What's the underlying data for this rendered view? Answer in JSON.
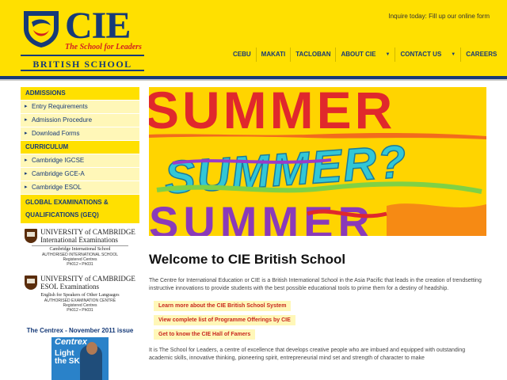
{
  "header": {
    "logo": {
      "name": "CIE",
      "tagline": "The School for Leaders",
      "subtitle": "BRITISH SCHOOL"
    },
    "inquire_text": "Inquire today: Fill up our online form",
    "nav": [
      {
        "label": "CEBU",
        "dropdown": false
      },
      {
        "label": "MAKATI",
        "dropdown": false
      },
      {
        "label": "TACLOBAN",
        "dropdown": false
      },
      {
        "label": "ABOUT CIE",
        "dropdown": true
      },
      {
        "label": "CONTACT US",
        "dropdown": true
      },
      {
        "label": "CAREERS",
        "dropdown": true
      }
    ],
    "colors": {
      "yellow": "#ffe000",
      "navy": "#163a78",
      "red": "#d22020"
    }
  },
  "sidebar": {
    "admissions": {
      "heading": "ADMISSIONS",
      "items": [
        "Entry Requirements",
        "Admission Procedure",
        "Download Forms"
      ]
    },
    "curriculum": {
      "heading": "CURRICULUM",
      "items": [
        "Cambridge IGCSE",
        "Cambridge GCE-A",
        "Cambridge ESOL"
      ]
    },
    "geq_heading_1": "GLOBAL EXAMINATIONS &",
    "geq_heading_2": "QUALIFICATIONS (GEQ)",
    "cambridge1": {
      "line1": "UNIVERSITY of CAMBRIDGE",
      "line2": "International Examinations",
      "sub": "Cambridge International School",
      "caps1": "AUTHORISED INTERNATIONAL SCHOOL",
      "caps2": "Registered Centres",
      "caps3": "Ph012  •  Ph031"
    },
    "cambridge2": {
      "line1": "UNIVERSITY of CAMBRIDGE",
      "line2": "ESOL Examinations",
      "sub": "English for Speakers of Other Languages",
      "caps1": "AUTHORISED EXAMINATION CENTRE",
      "caps2": "Registered Centres",
      "caps3": "Ph012  •  Ph031"
    },
    "centrex": {
      "title": "The Centrex - November 2011 issue",
      "cover_name": "Centrex",
      "cover_text_1": "Light",
      "cover_text_2": "the SKY"
    }
  },
  "banner": {
    "words": [
      "SUMMER",
      "SUMMER?",
      "SUMMER"
    ]
  },
  "main": {
    "title": "Welcome to CIE British School",
    "intro": "The Centre for International Education or CIE is a British International School in the Asia Pacific that leads in the creation of trendsetting instructive innovations to provide students with the best possible educational tools to prime them for a destiny of headship.",
    "links": [
      "Learn more about the CIE British School System",
      "View complete list of Programme Offerings by CIE",
      "Get to know the CIE Hall of Famers"
    ],
    "para2": "It is The School for Leaders, a centre of excellence that develops creative people who are imbued and equipped with outstanding academic skills, innovative thinking, pioneering spirit, entrepreneurial mind set and strength of character to make"
  }
}
